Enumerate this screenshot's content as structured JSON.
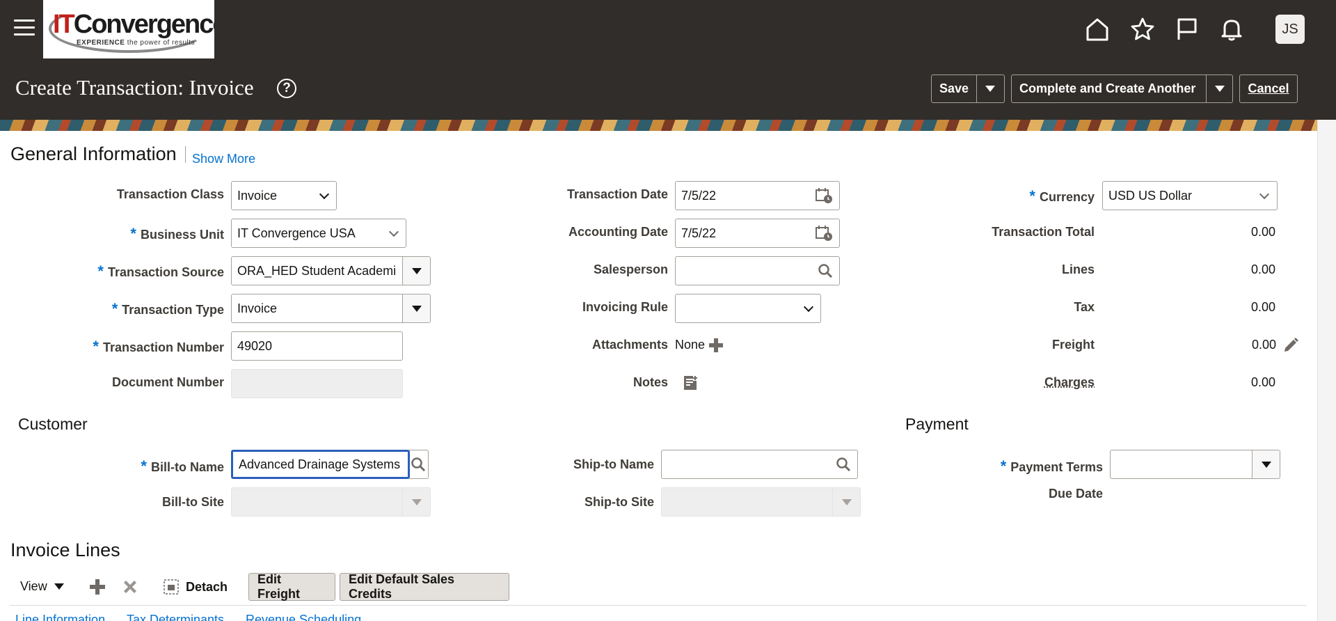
{
  "header": {
    "logo_text_red": "IT",
    "logo_text_black": "Convergence",
    "logo_tag_bold": "EXPERIENCE",
    "logo_tag_rest": " the power of results",
    "avatar_initials": "JS",
    "icons": [
      "menu-icon",
      "home-icon",
      "star-icon",
      "flag-icon",
      "bell-icon"
    ]
  },
  "page": {
    "title": "Create Transaction: Invoice",
    "help_icon": "?",
    "save_label": "Save",
    "complete_label": "Complete and Create Another",
    "cancel_label": "Cancel"
  },
  "general": {
    "title": "General Information",
    "show_more": "Show More",
    "left": {
      "transaction_class_label": "Transaction Class",
      "transaction_class_value": "Invoice",
      "business_unit_label": "Business Unit",
      "business_unit_value": "IT Convergence USA",
      "transaction_source_label": "Transaction Source",
      "transaction_source_value": "ORA_HED Student Academi",
      "transaction_type_label": "Transaction Type",
      "transaction_type_value": "Invoice",
      "transaction_number_label": "Transaction Number",
      "transaction_number_value": "49020",
      "document_number_label": "Document Number"
    },
    "middle": {
      "transaction_date_label": "Transaction Date",
      "transaction_date_value": "7/5/22",
      "accounting_date_label": "Accounting Date",
      "accounting_date_value": "7/5/22",
      "salesperson_label": "Salesperson",
      "invoicing_rule_label": "Invoicing Rule",
      "attachments_label": "Attachments",
      "attachments_value": "None",
      "notes_label": "Notes"
    },
    "right": {
      "currency_label": "Currency",
      "currency_value": "USD US Dollar",
      "transaction_total_label": "Transaction Total",
      "transaction_total_value": "0.00",
      "lines_label": "Lines",
      "lines_value": "0.00",
      "tax_label": "Tax",
      "tax_value": "0.00",
      "freight_label": "Freight",
      "freight_value": "0.00",
      "charges_label": "Charges",
      "charges_value": "0.00"
    }
  },
  "customer": {
    "title": "Customer",
    "bill_to_name_label": "Bill-to Name",
    "bill_to_name_value": "Advanced Drainage Systems",
    "bill_to_site_label": "Bill-to Site",
    "ship_to_name_label": "Ship-to Name",
    "ship_to_site_label": "Ship-to Site"
  },
  "payment": {
    "title": "Payment",
    "payment_terms_label": "Payment Terms",
    "due_date_label": "Due Date"
  },
  "invoice_lines": {
    "title": "Invoice Lines",
    "view_label": "View",
    "detach_label": "Detach",
    "edit_freight_label": "Edit Freight",
    "edit_sales_credits_label": "Edit Default Sales Credits",
    "tabs": [
      "Line Information",
      "Tax Determinants",
      "Revenue Scheduling"
    ]
  },
  "required_mark": "*"
}
